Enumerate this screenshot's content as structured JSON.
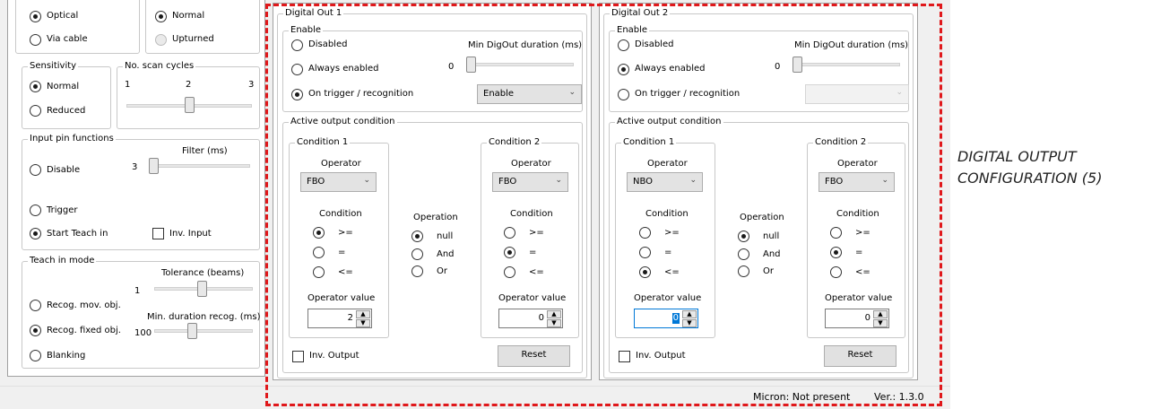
{
  "left": {
    "top_a": {
      "opt1": "Optical",
      "opt2": "Via cable"
    },
    "top_b": {
      "opt1": "Normal",
      "opt2": "Upturned"
    },
    "sensitivity": {
      "title": "Sensitivity",
      "opt1": "Normal",
      "opt2": "Reduced"
    },
    "scan": {
      "title": "No. scan cycles",
      "min": "1",
      "mid": "2",
      "max": "3",
      "value": 2
    },
    "input": {
      "title": "Input pin functions",
      "filter_label": "Filter (ms)",
      "filter_value": "3",
      "opt1": "Disable",
      "opt2": "Trigger",
      "opt3": "Start Teach in",
      "inv": "Inv. Input"
    },
    "teach": {
      "title": "Teach in mode",
      "tol_label": "Tolerance (beams)",
      "tol_value": "1",
      "dur_label": "Min. duration recog. (ms)",
      "dur_value": "100",
      "opt1": "Recog. mov. obj.",
      "opt2": "Recog. fixed obj.",
      "opt3": "Blanking"
    }
  },
  "do1": {
    "title": "Digital Out 1",
    "enable_title": "Enable",
    "opt1": "Disabled",
    "opt2": "Always enabled",
    "opt3": "On trigger / recognition",
    "min_label": "Min DigOut duration (ms)",
    "min_value": "0",
    "combo": "Enable",
    "active_title": "Active output condition",
    "c1": {
      "title": "Condition 1",
      "op_label": "Operator",
      "op": "FBO",
      "cond_label": "Condition",
      "r1": ">=",
      "r2": "=",
      "r3": "<=",
      "val_label": "Operator value",
      "val": "2"
    },
    "operation": {
      "label": "Operation",
      "r1": "null",
      "r2": "And",
      "r3": "Or"
    },
    "c2": {
      "title": "Condition 2",
      "op_label": "Operator",
      "op": "FBO",
      "cond_label": "Condition",
      "r1": ">=",
      "r2": "=",
      "r3": "<=",
      "val_label": "Operator value",
      "val": "0"
    },
    "inv": "Inv. Output",
    "reset": "Reset"
  },
  "do2": {
    "title": "Digital Out 2",
    "enable_title": "Enable",
    "opt1": "Disabled",
    "opt2": "Always enabled",
    "opt3": "On trigger / recognition",
    "min_label": "Min DigOut duration (ms)",
    "min_value": "0",
    "combo": "",
    "active_title": "Active output condition",
    "c1": {
      "title": "Condition 1",
      "op_label": "Operator",
      "op": "NBO",
      "cond_label": "Condition",
      "r1": ">=",
      "r2": "=",
      "r3": "<=",
      "val_label": "Operator value",
      "val": "0"
    },
    "operation": {
      "label": "Operation",
      "r1": "null",
      "r2": "And",
      "r3": "Or"
    },
    "c2": {
      "title": "Condition 2",
      "op_label": "Operator",
      "op": "FBO",
      "cond_label": "Condition",
      "r1": ">=",
      "r2": "=",
      "r3": "<=",
      "val_label": "Operator value",
      "val": "0"
    },
    "inv": "Inv. Output",
    "reset": "Reset"
  },
  "status": {
    "micron": "Micron: Not present",
    "version": "Ver.: 1.3.0"
  },
  "annotation": {
    "line1": "DIGITAL OUTPUT",
    "line2": "CONFIGURATION (5)"
  },
  "colors": {
    "highlight": "#e0181b",
    "panel": "#f0f0f0"
  },
  "icons": {
    "dropdown": "chevron-down-icon",
    "spin_up": "arrow-up-icon",
    "spin_down": "arrow-down-icon"
  }
}
